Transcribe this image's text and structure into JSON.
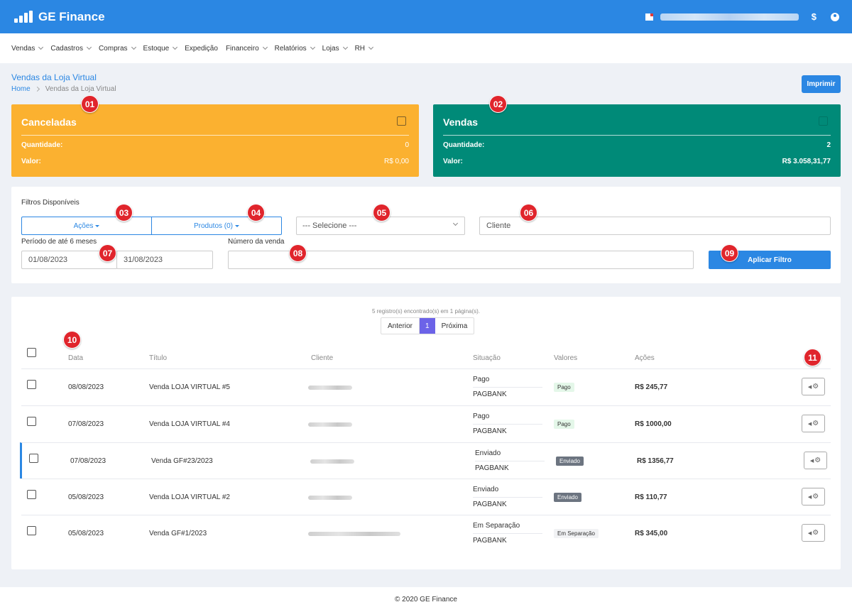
{
  "app": {
    "title": "GE Finance"
  },
  "topbar": {
    "dollar": "$"
  },
  "nav": [
    "Vendas",
    "Cadastros",
    "Compras",
    "Estoque",
    "Expedição",
    "Financeiro",
    "Relatórios",
    "Lojas",
    "RH"
  ],
  "nav_chevron": [
    true,
    true,
    true,
    true,
    false,
    true,
    true,
    true,
    true
  ],
  "page": {
    "title": "Vendas da Loja Virtual",
    "breadcrumb_home": "Home",
    "breadcrumb_current": "Vendas da Loja Virtual",
    "print_label": "Imprimir"
  },
  "cards": {
    "canceladas": {
      "title": "Canceladas",
      "qty_label": "Quantidade:",
      "qty": "0",
      "value_label": "Valor:",
      "value": "R$ 0,00"
    },
    "vendas": {
      "title": "Vendas",
      "qty_label": "Quantidade:",
      "qty": "2",
      "value_label": "Valor:",
      "value": "R$ 3.058,31,77"
    }
  },
  "filters": {
    "title": "Filtros Disponíveis",
    "acoes_label": "Ações",
    "produtos_label": "Produtos (0)",
    "select_value": "--- Selecione ---",
    "cliente_placeholder": "Cliente",
    "periodo_label": "Período de até 6 meses",
    "date_start": "01/08/2023",
    "date_end": "31/08/2023",
    "numero_label": "Número da venda",
    "numero_value": "",
    "apply_label": "Aplicar Filtro"
  },
  "table": {
    "records_text": "5 registro(s) encontrado(s) em 1 página(s).",
    "pager": {
      "prev": "Anterior",
      "current": "1",
      "next": "Próxima"
    },
    "headers": {
      "data": "Data",
      "titulo": "Título",
      "cliente": "Cliente",
      "situacao": "Situação",
      "valores": "Valores",
      "acoes": "Ações"
    },
    "rows": [
      {
        "date": "08/08/2023",
        "title": "Venda LOJA VIRTUAL #5",
        "status": "Pago",
        "gateway": "PAGBANK",
        "badge": "Pago",
        "badge_type": "pago",
        "value": "R$ 245,77",
        "selected": false
      },
      {
        "date": "07/08/2023",
        "title": "Venda LOJA VIRTUAL #4",
        "status": "Pago",
        "gateway": "PAGBANK",
        "badge": "Pago",
        "badge_type": "pago",
        "value": "R$ 1000,00",
        "selected": false
      },
      {
        "date": "07/08/2023",
        "title": "Venda GF#23/2023",
        "status": "Enviado",
        "gateway": "PAGBANK",
        "badge": "Enviado",
        "badge_type": "enviado",
        "value": "R$ 1356,77",
        "selected": true
      },
      {
        "date": "05/08/2023",
        "title": "Venda LOJA VIRTUAL #2",
        "status": "Enviado",
        "gateway": "PAGBANK",
        "badge": "Enviado",
        "badge_type": "enviado",
        "value": "R$ 110,77",
        "selected": false
      },
      {
        "date": "05/08/2023",
        "title": "Venda GF#1/2023",
        "status": "Em Separação",
        "gateway": "PAGBANK",
        "badge": "Em Separação",
        "badge_type": "sep",
        "value": "R$ 345,00",
        "selected": false
      }
    ]
  },
  "markers": [
    "01",
    "02",
    "03",
    "04",
    "05",
    "06",
    "07",
    "08",
    "09",
    "10",
    "11"
  ],
  "footer": "© 2020 GE Finance",
  "colors": {
    "primary": "#2b87e3",
    "orange": "#fbb130",
    "teal": "#008a78",
    "marker": "#e0252c",
    "pager_active": "#6c63e8"
  },
  "icons": [
    "logo-bars-icon",
    "flag-icon",
    "dollar-icon",
    "user-icon",
    "chevron-down-icon",
    "chevron-right-icon",
    "checkbox-icon",
    "gear-icon",
    "caret-left-icon"
  ]
}
